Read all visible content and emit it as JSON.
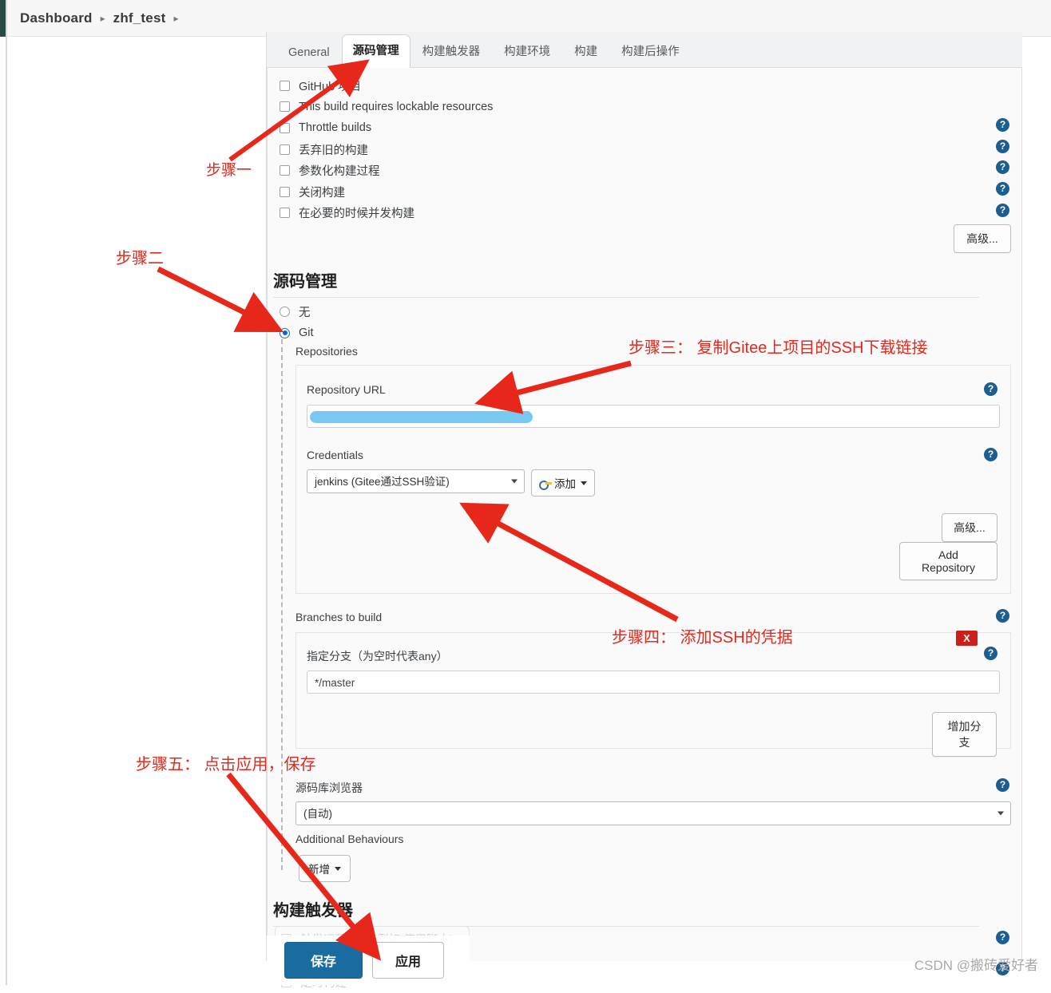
{
  "breadcrumb": {
    "items": [
      "Dashboard",
      "zhf_test"
    ],
    "separator": "▸"
  },
  "tabs": [
    {
      "label": "General",
      "active": false
    },
    {
      "label": "源码管理",
      "active": true
    },
    {
      "label": "构建触发器",
      "active": false
    },
    {
      "label": "构建环境",
      "active": false
    },
    {
      "label": "构建",
      "active": false
    },
    {
      "label": "构建后操作",
      "active": false
    }
  ],
  "general_options": [
    {
      "label": "GitHub 项目",
      "checked": false
    },
    {
      "label": "This build requires lockable resources",
      "checked": false
    },
    {
      "label": "Throttle builds",
      "checked": false
    },
    {
      "label": "丢弃旧的构建",
      "checked": false
    },
    {
      "label": "参数化构建过程",
      "checked": false
    },
    {
      "label": "关闭构建",
      "checked": false
    },
    {
      "label": "在必要的时候并发构建",
      "checked": false
    }
  ],
  "advanced_button_top": "高级...",
  "scm": {
    "heading": "源码管理",
    "radios": [
      {
        "label": "无",
        "selected": false
      },
      {
        "label": "Git",
        "selected": true
      }
    ],
    "repositories_label": "Repositories",
    "repository_url_label": "Repository URL",
    "repository_url_value": "",
    "credentials_label": "Credentials",
    "credentials_value": "jenkins (Gitee通过SSH验证)",
    "add_credential_label": "添加",
    "advanced_label": "高级...",
    "add_repository_label": "Add Repository",
    "branches_label": "Branches to build",
    "branch_specifier_label": "指定分支（为空时代表any）",
    "branch_specifier_value": "*/master",
    "add_branch_label": "增加分支",
    "delete_label": "X",
    "browser_label": "源码库浏览器",
    "browser_value": "(自动)",
    "additional_behaviours_label": "Additional Behaviours",
    "add_behaviour_label": "新增"
  },
  "triggers": {
    "heading": "构建触发器",
    "options": [
      {
        "label": "触发远程构建 (例如,使用脚本)",
        "checked": false
      },
      {
        "label": "",
        "checked": false
      },
      {
        "label": "定时构建",
        "checked": false
      }
    ]
  },
  "actions": {
    "save_label": "保存",
    "apply_label": "应用"
  },
  "annotations": [
    {
      "id": "step1",
      "text": "步骤一"
    },
    {
      "id": "step2",
      "text": "步骤二"
    },
    {
      "id": "step3",
      "text": "步骤三： 复制Gitee上项目的SSH下载链接"
    },
    {
      "id": "step4",
      "text": "步骤四： 添加SSH的凭据"
    },
    {
      "id": "step5",
      "text": "步骤五： 点击应用，保存"
    }
  ],
  "watermark": "CSDN @搬砖爱好者",
  "icons": {
    "help": "?",
    "caret": "chevron-down-icon",
    "key": "key-icon"
  },
  "colors": {
    "accent": "#1a6ba0",
    "annotation_red": "#e02a1e",
    "help_blue": "#1d5e91",
    "redaction_blue": "#77c9f2",
    "delete_red": "#cc1f1a",
    "panel_bg": "#fafafa"
  }
}
